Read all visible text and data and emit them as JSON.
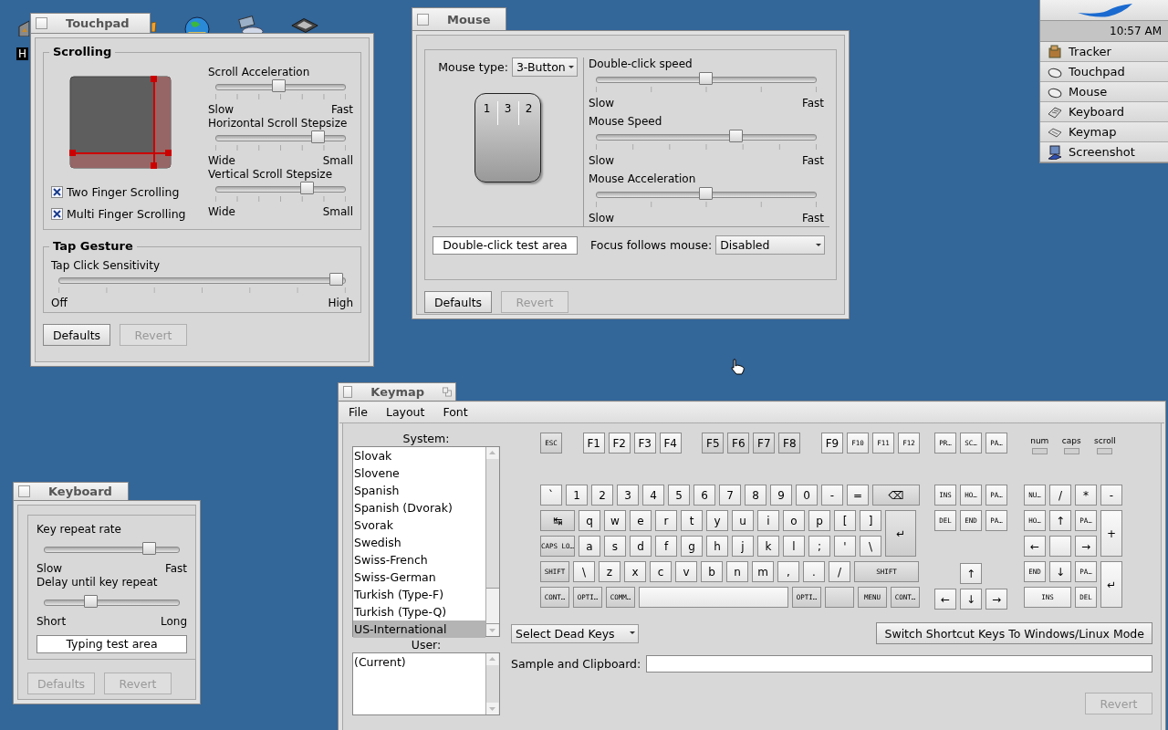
{
  "desktop_icons": [
    {
      "kind": "drive",
      "label": "H"
    },
    {
      "kind": "folder"
    },
    {
      "kind": "globe"
    },
    {
      "kind": "package"
    },
    {
      "kind": "printer"
    }
  ],
  "deskbar": {
    "clock": "10:57 AM",
    "items": [
      {
        "label": "Tracker",
        "kind": "tracker"
      },
      {
        "label": "Touchpad",
        "kind": "mouse"
      },
      {
        "label": "Mouse",
        "kind": "mouse"
      },
      {
        "label": "Keyboard",
        "kind": "keyboard"
      },
      {
        "label": "Keymap",
        "kind": "keymap"
      },
      {
        "label": "Screenshot",
        "kind": "screenshot"
      }
    ]
  },
  "touchpad": {
    "title": "Touchpad",
    "scrolling": {
      "heading": "Scrolling",
      "checkboxes": [
        {
          "label": "Two Finger Scrolling",
          "checked": true
        },
        {
          "label": "Multi Finger Scrolling",
          "checked": true
        }
      ],
      "sliders": [
        {
          "label": "Scroll Acceleration",
          "level": 0.49,
          "min_label": "Slow",
          "max_label": "Fast"
        },
        {
          "label": "Horizontal Scroll Stepsize",
          "level": 0.84,
          "min_label": "Wide",
          "max_label": "Small"
        },
        {
          "label": "Vertical Scroll Stepsize",
          "level": 0.74,
          "min_label": "Wide",
          "max_label": "Small"
        }
      ]
    },
    "tap": {
      "heading": "Tap Gesture",
      "sliders": [
        {
          "label": "Tap Click Sensitivity",
          "level": 1,
          "min_label": "Off",
          "max_label": "High"
        }
      ]
    },
    "buttons": [
      {
        "label": "Defaults",
        "disabled": false
      },
      {
        "label": "Revert",
        "disabled": true
      }
    ]
  },
  "mouse": {
    "title": "Mouse",
    "type_label": "Mouse type:",
    "type_value": "3-Button",
    "mouse_buttons": [
      "1",
      "3",
      "2"
    ],
    "sliders": [
      {
        "label": "Double-click speed",
        "level": 0.5,
        "min_label": "Slow",
        "max_label": "Fast"
      },
      {
        "label": "Mouse Speed",
        "level": 0.65,
        "min_label": "Slow",
        "max_label": "Fast"
      },
      {
        "label": "Mouse Acceleration",
        "level": 0.5,
        "min_label": "Slow",
        "max_label": "Fast"
      }
    ],
    "test_area": "Double-click test area",
    "focus_label": "Focus follows mouse:",
    "focus_value": "Disabled",
    "buttons": [
      {
        "label": "Defaults",
        "disabled": false
      },
      {
        "label": "Revert",
        "disabled": true
      }
    ]
  },
  "keyboard": {
    "title": "Keyboard",
    "sliders": [
      {
        "label": "Key repeat rate",
        "level": 0.82,
        "min_label": "Slow",
        "max_label": "Fast"
      },
      {
        "label": "Delay until key repeat",
        "level": 0.33,
        "min_label": "Short",
        "max_label": "Long"
      }
    ],
    "test_area": "Typing test area",
    "buttons": [
      {
        "label": "Defaults",
        "disabled": true
      },
      {
        "label": "Revert",
        "disabled": true
      }
    ]
  },
  "keymap": {
    "title": "Keymap",
    "menu": [
      "File",
      "Layout",
      "Font"
    ],
    "system_label": "System:",
    "system_layouts": [
      {
        "label": "Slovak",
        "selected": false
      },
      {
        "label": "Slovene",
        "selected": false
      },
      {
        "label": "Spanish",
        "selected": false
      },
      {
        "label": "Spanish (Dvorak)",
        "selected": false
      },
      {
        "label": "Svorak",
        "selected": false
      },
      {
        "label": "Swedish",
        "selected": false
      },
      {
        "label": "Swiss-French",
        "selected": false
      },
      {
        "label": "Swiss-German",
        "selected": false
      },
      {
        "label": "Turkish (Type-F)",
        "selected": false
      },
      {
        "label": "Turkish (Type-Q)",
        "selected": false
      },
      {
        "label": "US-International",
        "selected": true
      }
    ],
    "user_label": "User:",
    "user_layouts": [
      {
        "label": "(Current)",
        "selected": false
      }
    ],
    "keyboard": {
      "function_keys": [
        [
          {
            "label": "ESC",
            "kind": "mod"
          }
        ],
        [
          {
            "label": "F1",
            "kind": "key"
          },
          {
            "label": "F2",
            "kind": "key"
          },
          {
            "label": "F3",
            "kind": "key"
          },
          {
            "label": "F4",
            "kind": "key"
          }
        ],
        [
          {
            "label": "F5",
            "kind": "mod"
          },
          {
            "label": "F6",
            "kind": "mod"
          },
          {
            "label": "F7",
            "kind": "mod"
          },
          {
            "label": "F8",
            "kind": "mod"
          }
        ],
        [
          {
            "label": "F9",
            "kind": "key"
          },
          {
            "label": "F10",
            "kind": "key"
          },
          {
            "label": "F11",
            "kind": "key"
          },
          {
            "label": "F12",
            "kind": "key"
          }
        ]
      ],
      "main_rows": [
        [
          {
            "label": "`",
            "kind": "key"
          },
          {
            "label": "1",
            "kind": "key"
          },
          {
            "label": "2",
            "kind": "key"
          },
          {
            "label": "3",
            "kind": "key"
          },
          {
            "label": "4",
            "kind": "key"
          },
          {
            "label": "5",
            "kind": "key"
          },
          {
            "label": "6",
            "kind": "key"
          },
          {
            "label": "7",
            "kind": "key"
          },
          {
            "label": "8",
            "kind": "key"
          },
          {
            "label": "9",
            "kind": "key"
          },
          {
            "label": "0",
            "kind": "key"
          },
          {
            "label": "-",
            "kind": "key"
          },
          {
            "label": "=",
            "kind": "key"
          },
          {
            "label": "⌫",
            "kind": "back"
          }
        ],
        [
          {
            "label": "↹",
            "kind": "tab"
          },
          {
            "label": "q",
            "kind": "key"
          },
          {
            "label": "w",
            "kind": "key"
          },
          {
            "label": "e",
            "kind": "key"
          },
          {
            "label": "r",
            "kind": "key"
          },
          {
            "label": "t",
            "kind": "key"
          },
          {
            "label": "y",
            "kind": "key"
          },
          {
            "label": "u",
            "kind": "key"
          },
          {
            "label": "i",
            "kind": "key"
          },
          {
            "label": "o",
            "kind": "key"
          },
          {
            "label": "p",
            "kind": "key"
          },
          {
            "label": "[",
            "kind": "key"
          },
          {
            "label": "]",
            "kind": "key"
          },
          {
            "label": "↵",
            "kind": "enter"
          }
        ],
        [
          {
            "label": "CAPS LO…",
            "kind": "caps"
          },
          {
            "label": "a",
            "kind": "key"
          },
          {
            "label": "s",
            "kind": "key"
          },
          {
            "label": "d",
            "kind": "key"
          },
          {
            "label": "f",
            "kind": "key"
          },
          {
            "label": "g",
            "kind": "key"
          },
          {
            "label": "h",
            "kind": "key"
          },
          {
            "label": "j",
            "kind": "key"
          },
          {
            "label": "k",
            "kind": "key"
          },
          {
            "label": "l",
            "kind": "key"
          },
          {
            "label": ";",
            "kind": "key"
          },
          {
            "label": "'",
            "kind": "key"
          },
          {
            "label": "\\",
            "kind": "key"
          }
        ],
        [
          {
            "label": "SHIFT",
            "kind": "lshift"
          },
          {
            "label": "\\",
            "kind": "key"
          },
          {
            "label": "z",
            "kind": "key"
          },
          {
            "label": "x",
            "kind": "key"
          },
          {
            "label": "c",
            "kind": "key"
          },
          {
            "label": "v",
            "kind": "key"
          },
          {
            "label": "b",
            "kind": "key"
          },
          {
            "label": "n",
            "kind": "key"
          },
          {
            "label": "m",
            "kind": "key"
          },
          {
            "label": ",",
            "kind": "key"
          },
          {
            "label": ".",
            "kind": "key"
          },
          {
            "label": "/",
            "kind": "key"
          },
          {
            "label": "SHIFT",
            "kind": "rshift"
          }
        ],
        [
          {
            "label": "CONT…",
            "kind": "cmod"
          },
          {
            "label": "OPTI…",
            "kind": "cmod"
          },
          {
            "label": "COMM…",
            "kind": "cmod"
          },
          {
            "kind": "space"
          },
          {
            "label": "OPTI…",
            "kind": "cmod"
          },
          {
            "kind": "cmod"
          },
          {
            "label": "MENU",
            "kind": "cmod"
          },
          {
            "label": "CONT…",
            "kind": "cmod"
          }
        ]
      ],
      "system_keys": [
        {
          "label": "PR…",
          "kind": "key"
        },
        {
          "label": "SC…",
          "kind": "key"
        },
        {
          "label": "PA…",
          "kind": "key"
        }
      ],
      "nav_keys": [
        [
          {
            "label": "INS",
            "kind": "key"
          },
          {
            "label": "HO…",
            "kind": "key"
          },
          {
            "label": "PA…",
            "kind": "key"
          }
        ],
        [
          {
            "label": "DEL",
            "kind": "key"
          },
          {
            "label": "END",
            "kind": "key"
          },
          {
            "label": "PA…",
            "kind": "key"
          }
        ]
      ],
      "arrow_keys": [
        [
          {
            "label": "↑",
            "kind": "key"
          }
        ],
        [
          {
            "label": "←",
            "kind": "key"
          },
          {
            "label": "↓",
            "kind": "key"
          },
          {
            "label": "→",
            "kind": "key"
          }
        ]
      ],
      "indicators": [
        {
          "label": "num",
          "on": false
        },
        {
          "label": "caps",
          "on": false
        },
        {
          "label": "scroll",
          "on": false
        }
      ],
      "numpad": [
        {
          "label": "NU…",
          "kind": "key"
        },
        {
          "label": "/",
          "kind": "key"
        },
        {
          "label": "*",
          "kind": "key"
        },
        {
          "label": "-",
          "kind": "key"
        },
        {
          "label": "HO…",
          "kind": "key"
        },
        {
          "label": "↑",
          "kind": "key"
        },
        {
          "label": "PA…",
          "kind": "key"
        },
        {
          "label": "+",
          "kind": "tall"
        },
        {
          "label": "←",
          "kind": "key"
        },
        {
          "kind": "key"
        },
        {
          "label": "→",
          "kind": "key"
        },
        {
          "label": "END",
          "kind": "key"
        },
        {
          "label": "↓",
          "kind": "key"
        },
        {
          "label": "PA…",
          "kind": "key"
        },
        {
          "label": "↵",
          "kind": "tall"
        },
        {
          "label": "INS",
          "kind": "wide"
        },
        {
          "label": "DEL",
          "kind": "key"
        }
      ]
    },
    "dead_keys": "Select Dead Keys",
    "switch_button": "Switch Shortcut Keys To Windows/Linux Mode",
    "sample_label": "Sample and Clipboard:",
    "buttons": [
      {
        "label": "Revert",
        "disabled": true
      }
    ]
  }
}
